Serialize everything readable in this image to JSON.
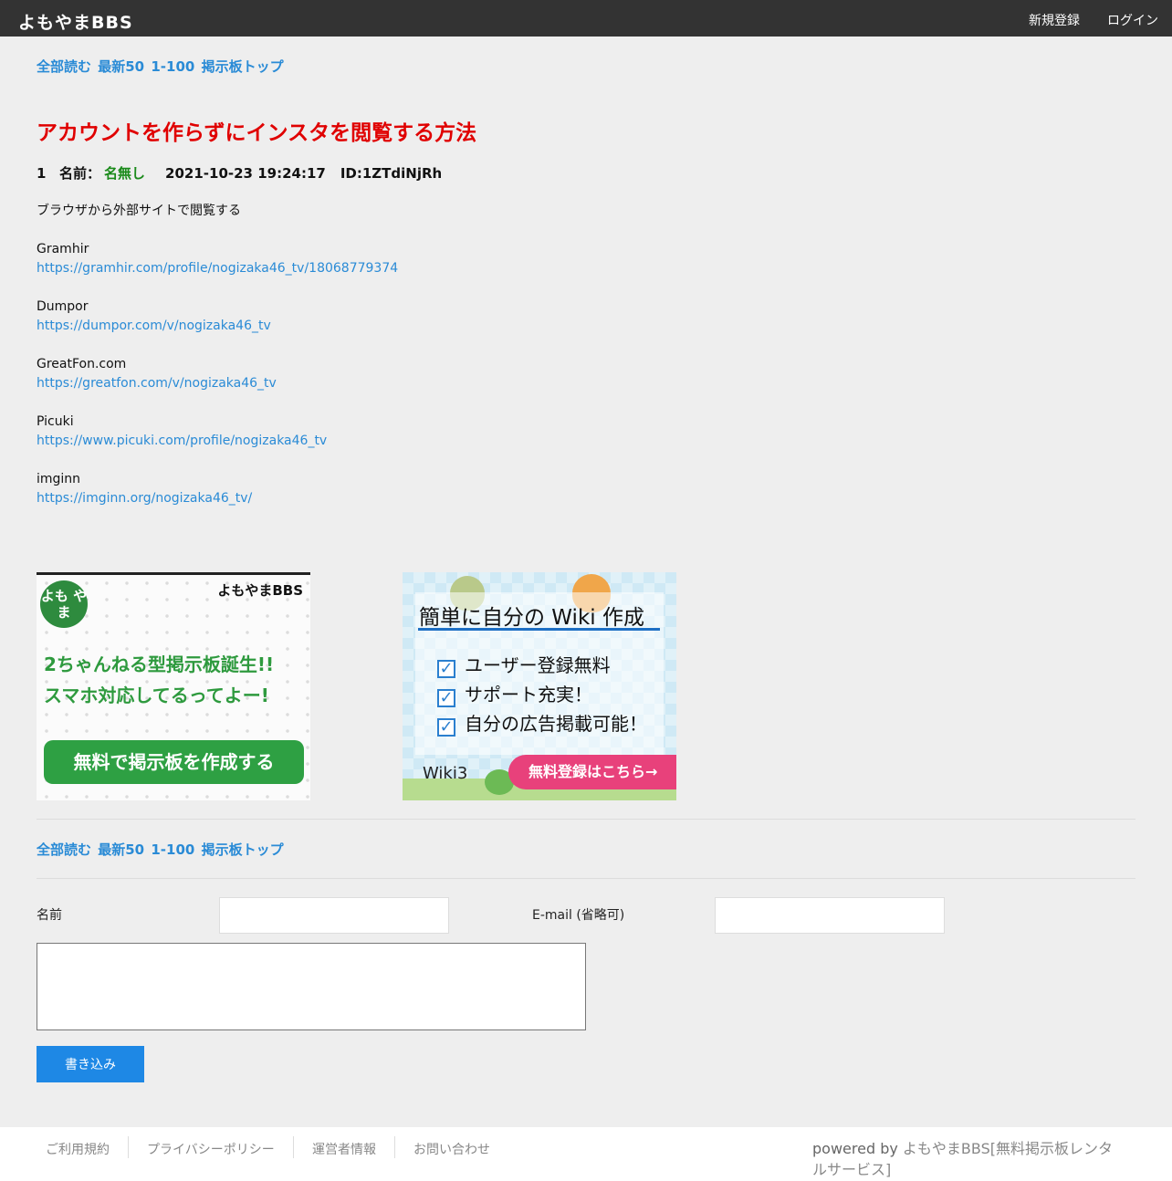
{
  "header": {
    "logo": "よもやまBBS",
    "register": "新規登録",
    "login": "ログイン"
  },
  "nav": {
    "read_all": "全部読む",
    "latest50": "最新50",
    "range": "1-100",
    "board_top": "掲示板トップ"
  },
  "thread": {
    "title": "アカウントを作らずにインスタを閲覧する方法"
  },
  "post": {
    "number": "1",
    "name_label": "名前：",
    "name": "名無し",
    "datetime": "2021-10-23 19:24:17",
    "id": "ID:1ZTdiNjRh",
    "intro": "ブラウザから外部サイトで閲覧する",
    "sites": [
      {
        "name": "Gramhir",
        "url": "https://gramhir.com/profile/nogizaka46_tv/18068779374"
      },
      {
        "name": "Dumpor",
        "url": "https://dumpor.com/v/nogizaka46_tv"
      },
      {
        "name": "GreatFon.com",
        "url": "https://greatfon.com/v/nogizaka46_tv"
      },
      {
        "name": "Picuki",
        "url": "https://www.picuki.com/profile/nogizaka46_tv"
      },
      {
        "name": "imginn",
        "url": "https://imginn.org/nogizaka46_tv/"
      }
    ]
  },
  "ads": {
    "bbs": {
      "badge": "よも やま",
      "brand": "よもやまBBS",
      "line1": "2ちゃんねる型掲示板誕生!!",
      "line2": "スマホ対応してるってよー!",
      "cta": "無料で掲示板を作成する"
    },
    "wiki": {
      "title": "簡単に自分の Wiki 作成",
      "items": [
        "ユーザー登録無料",
        "サポート充実！",
        "自分の広告掲載可能！"
      ],
      "brand": "Wiki3",
      "cta": "無料登録はこちら→"
    }
  },
  "form": {
    "name_label": "名前",
    "email_label": "E-mail (省略可)",
    "submit": "書き込み"
  },
  "footer": {
    "terms": "ご利用規約",
    "privacy": "プライバシーポリシー",
    "operator": "運営者情報",
    "contact": "お問い合わせ",
    "powered_by": "powered by",
    "service": "よもやまBBS[無料掲示板レンタルサービス]"
  },
  "colors": {
    "topbar": "#333333",
    "link": "#2a8bd6",
    "title_red": "#e00000",
    "name_green": "#1a8a1a",
    "submit_blue": "#1e88e5"
  }
}
